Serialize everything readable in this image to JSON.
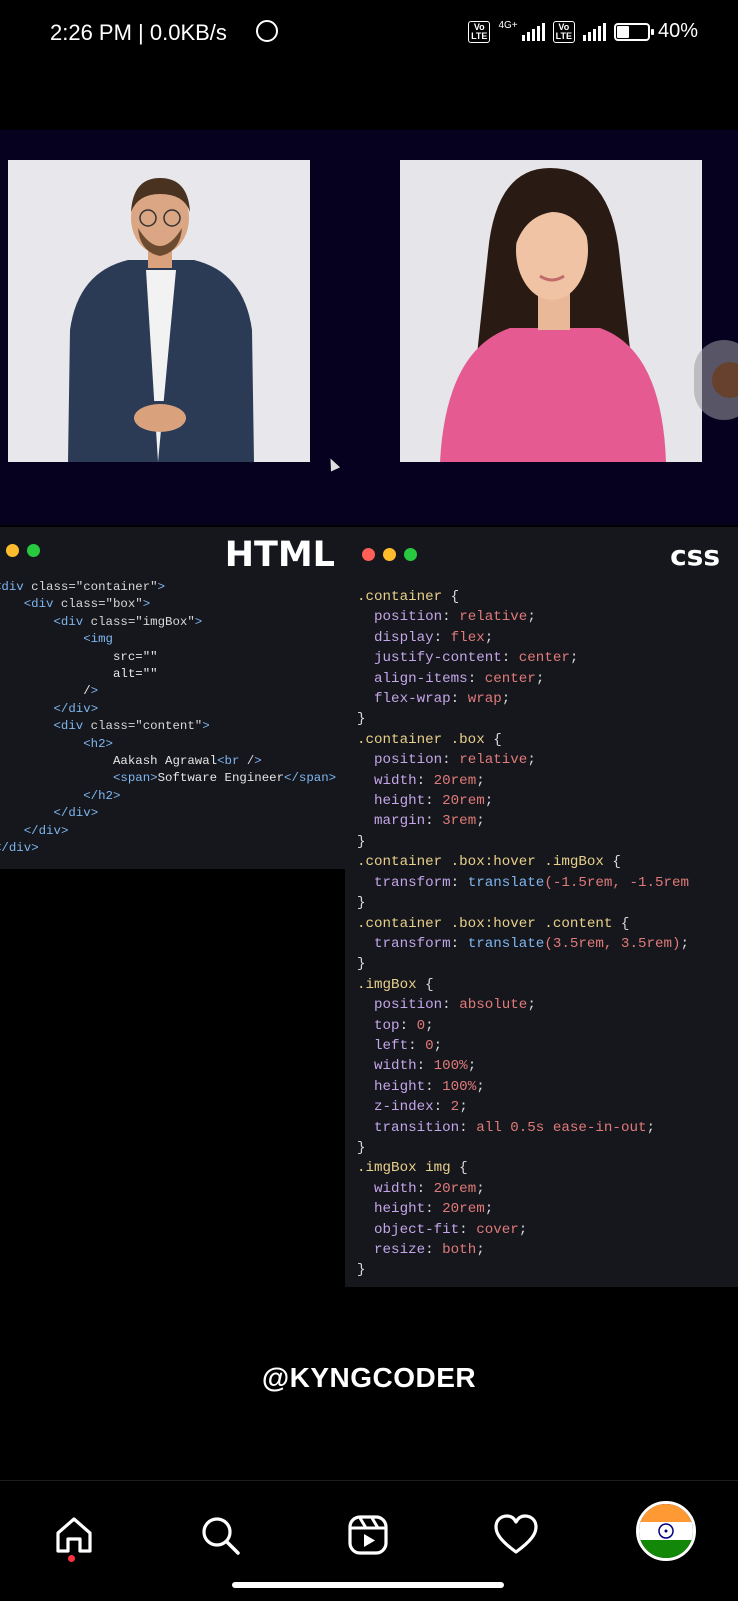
{
  "status_bar": {
    "time_speed": "2:26 PM | 0.0KB/s",
    "sim1_tag": "Vo\nLTE",
    "sim1_net": "4G+",
    "sim2_tag": "Vo\nLTE",
    "battery_percent": "40%",
    "battery_level": 0.4
  },
  "html_panel": {
    "title": "HTML",
    "lines": [
      "<div class=\"container\">",
      "    <div class=\"box\">",
      "        <div class=\"imgBox\">",
      "            <img",
      "                src=\"\"",
      "                alt=\"\"",
      "            />",
      "        </div>",
      "        <div class=\"content\">",
      "            <h2>",
      "                Aakash Agrawal<br />",
      "                <span>Software Engineer</span>",
      "            </h2>",
      "        </div>",
      "    </div>",
      "</div>"
    ]
  },
  "css_panel": {
    "title": "css",
    "lines": [
      ".container {",
      "  position: relative;",
      "  display: flex;",
      "  justify-content: center;",
      "  align-items: center;",
      "  flex-wrap: wrap;",
      "}",
      ".container .box {",
      "  position: relative;",
      "  width: 20rem;",
      "  height: 20rem;",
      "  margin: 3rem;",
      "}",
      ".container .box:hover .imgBox {",
      "  transform: translate(-1.5rem, -1.5rem",
      "}",
      ".container .box:hover .content {",
      "  transform: translate(3.5rem, 3.5rem);",
      "}",
      ".imgBox {",
      "  position: absolute;",
      "  top: 0;",
      "  left: 0;",
      "  width: 100%;",
      "  height: 100%;",
      "  z-index: 2;",
      "  transition: all 0.5s ease-in-out;",
      "}",
      ".imgBox img {",
      "  width: 20rem;",
      "  height: 20rem;",
      "  object-fit: cover;",
      "  resize: both;",
      "}"
    ]
  },
  "watermark": "@KYNGCODER",
  "nav": {
    "items": [
      "home-icon",
      "search-icon",
      "reels-icon",
      "heart-icon",
      "profile-avatar"
    ]
  },
  "colors": {
    "demo_bg": "#05011f",
    "code_bg": "#15171c",
    "dot_red": "#ff5f56",
    "dot_yellow": "#ffbd2e",
    "dot_green": "#27c93f"
  }
}
